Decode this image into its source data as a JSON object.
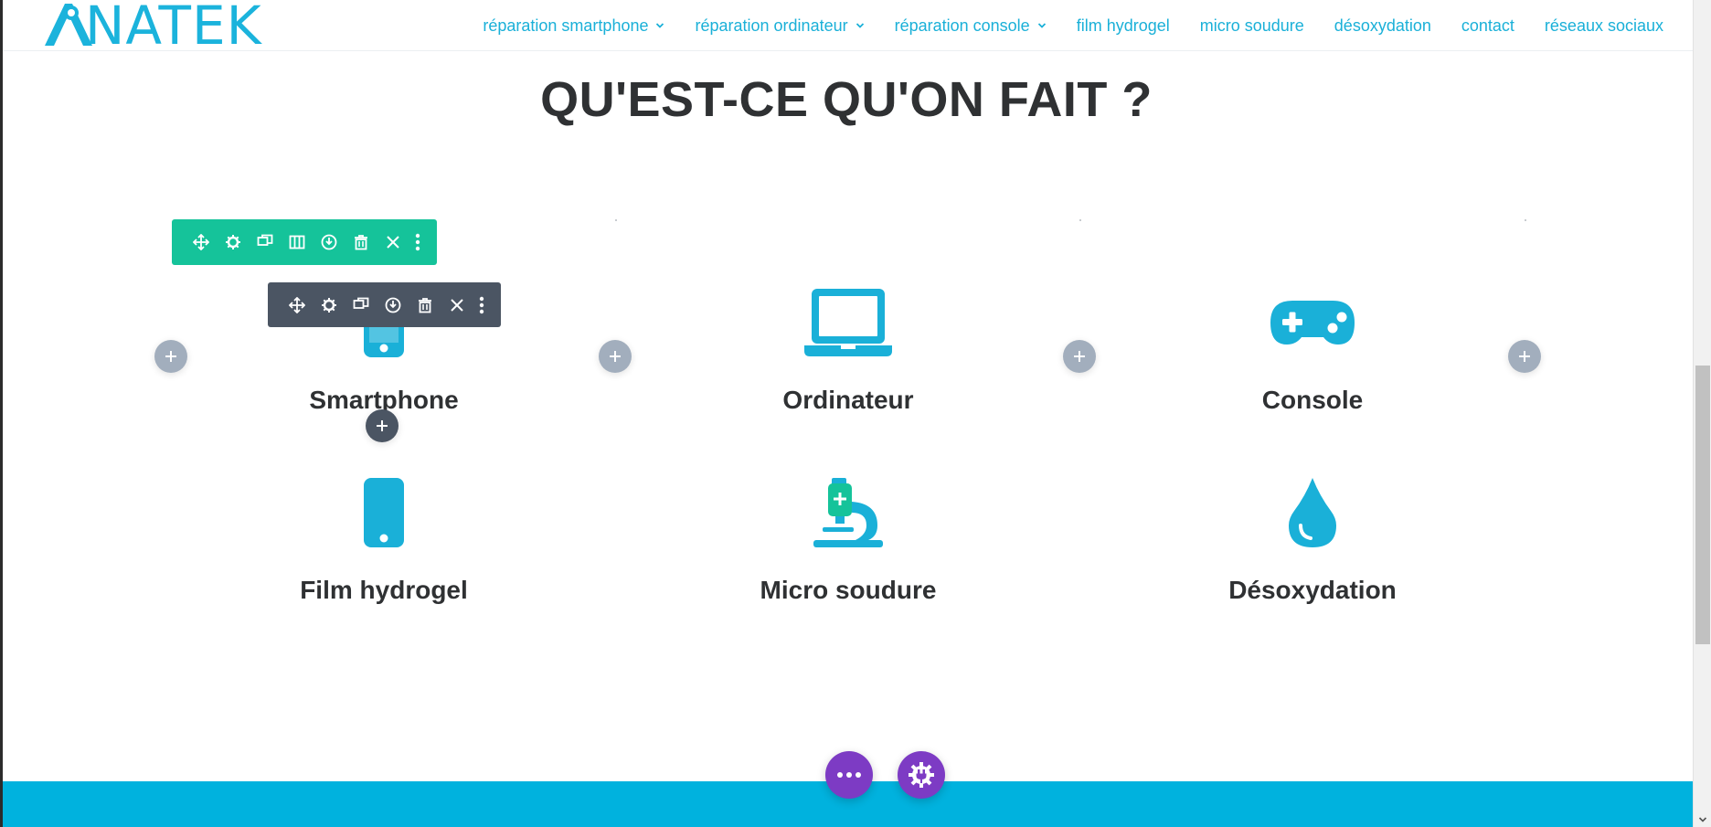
{
  "brand": {
    "logo_text": "NATEK",
    "accent": "#1ab0d8",
    "row_toolbar_color": "#15c39a",
    "module_toolbar_color": "#4b5563",
    "fab_color": "#7d3bc4",
    "footer_color": "#00b2de"
  },
  "nav": {
    "items": [
      {
        "label": "réparation smartphone",
        "has_dropdown": true
      },
      {
        "label": "réparation ordinateur",
        "has_dropdown": true
      },
      {
        "label": "réparation console",
        "has_dropdown": true
      },
      {
        "label": "film hydrogel",
        "has_dropdown": false
      },
      {
        "label": "micro soudure",
        "has_dropdown": false
      },
      {
        "label": "désoxydation",
        "has_dropdown": false
      },
      {
        "label": "contact",
        "has_dropdown": false
      },
      {
        "label": "réseaux sociaux",
        "has_dropdown": false
      }
    ]
  },
  "section": {
    "title": "QU'EST-CE QU'ON FAIT ?"
  },
  "services": [
    {
      "label": "Smartphone",
      "icon": "smartphone-icon"
    },
    {
      "label": "Ordinateur",
      "icon": "laptop-icon"
    },
    {
      "label": "Console",
      "icon": "gamepad-icon"
    },
    {
      "label": "Film hydrogel",
      "icon": "mobile-icon"
    },
    {
      "label": "Micro soudure",
      "icon": "microscope-icon"
    },
    {
      "label": "Désoxydation",
      "icon": "water-drop-icon"
    }
  ],
  "row_toolbar": {
    "buttons": [
      "move-icon",
      "settings-icon",
      "duplicate-icon",
      "columns-icon",
      "save-icon",
      "delete-icon",
      "close-icon",
      "more-icon"
    ]
  },
  "module_toolbar": {
    "buttons": [
      "move-icon",
      "settings-icon",
      "duplicate-icon",
      "save-icon",
      "delete-icon",
      "close-icon",
      "more-icon"
    ]
  },
  "floating": {
    "left": "more-options-icon",
    "right": "plugin-settings-icon"
  }
}
